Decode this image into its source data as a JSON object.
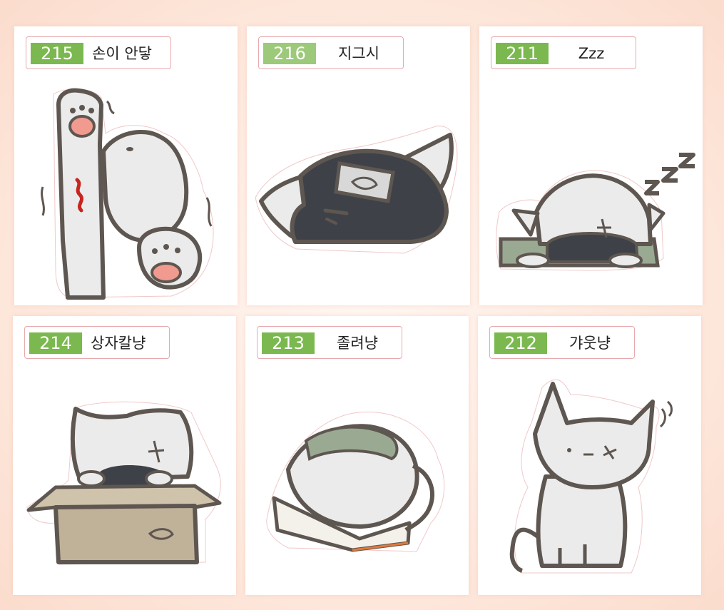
{
  "stickers": [
    {
      "number": "215",
      "title": "손이 안닿"
    },
    {
      "number": "216",
      "title": "지그시"
    },
    {
      "number": "211",
      "title": "Zzz"
    },
    {
      "number": "214",
      "title": "상자칼냥"
    },
    {
      "number": "213",
      "title": "졸려냥"
    },
    {
      "number": "212",
      "title": "갸웃냥"
    }
  ],
  "colors": {
    "background": "#fde9df",
    "label_green": "#7bb84f",
    "label_border": "#e7a9ad",
    "outline": "#5e5650",
    "cat_fill": "#ebebeb",
    "mask_dark": "#3e4248",
    "cloth_green": "#9aaa92",
    "box_brown": "#bfb298",
    "accent_red": "#c8251e"
  }
}
